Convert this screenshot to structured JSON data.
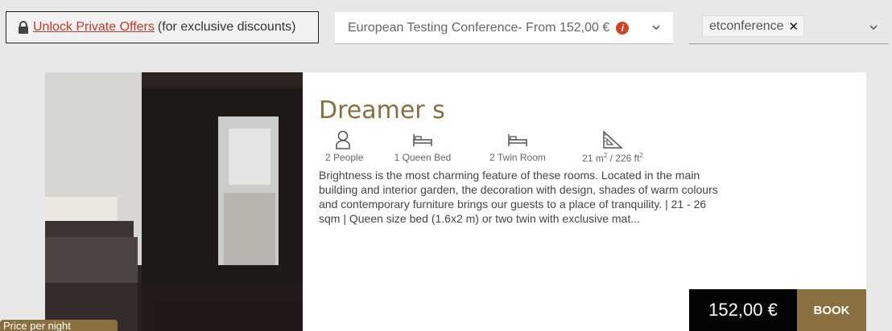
{
  "offers": {
    "unlock_link": "Unlock Private Offers",
    "unlock_suffix": "(for exclusive discounts)"
  },
  "rate_select": {
    "selected": "European Testing Conference- From  152,00 €"
  },
  "promo_select": {
    "tag": "etconference"
  },
  "room": {
    "title": "Dreamer s",
    "features": [
      {
        "icon": "person-icon",
        "label": "2 People"
      },
      {
        "icon": "queen-bed-icon",
        "label": "1 Queen Bed"
      },
      {
        "icon": "twin-bed-icon",
        "label": "2 Twin Room"
      },
      {
        "icon": "area-icon",
        "label_main": "21 m",
        "sup1": "2",
        "label_mid": " / 226 ft",
        "sup2": "2"
      }
    ],
    "description": "Brightness is the most charming feature of these rooms. Located in the main building and interior garden, the decoration with design, shades of warm colours and contemporary furniture brings our guests to a place of tranquility. | 21 - 26 sqm | Queen size bed (1.6x2 m) or two twin with exclusive mat...",
    "price": "152,00 €",
    "book_label": "BOOK"
  },
  "bottom_tab": {
    "label": "Price per night"
  },
  "colors": {
    "accent": "#8a7040",
    "link": "#c0392b",
    "info": "#d0441f"
  }
}
